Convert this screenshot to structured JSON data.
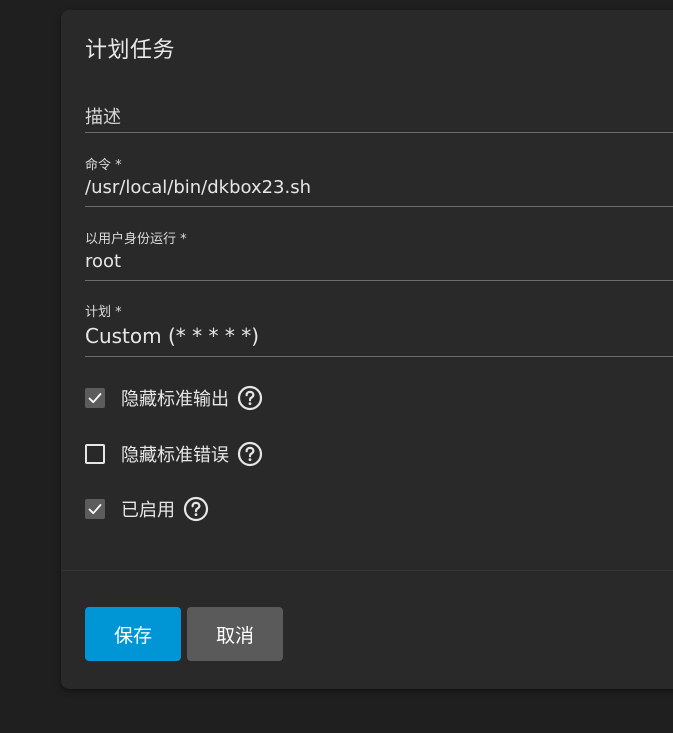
{
  "dialog": {
    "title": "计划任务",
    "fields": {
      "description": {
        "placeholder": "描述",
        "value": ""
      },
      "command": {
        "label": "命令 *",
        "value": "/usr/local/bin/dkbox23.sh"
      },
      "run_as_user": {
        "label": "以用户身份运行 *",
        "value": "root"
      },
      "schedule": {
        "label": "计划 *",
        "value": "Custom (* * * * *)"
      }
    },
    "checkboxes": [
      {
        "label": "隐藏标准输出",
        "checked": true
      },
      {
        "label": "隐藏标准错误",
        "checked": false
      },
      {
        "label": "已启用",
        "checked": true
      }
    ],
    "buttons": {
      "save": "保存",
      "cancel": "取消"
    }
  },
  "colors": {
    "page_background": "#1f1f1f",
    "dialog_background": "#292929",
    "primary_button": "#0095d5",
    "secondary_button": "#5a5a5a"
  },
  "icons": {
    "check": "check-icon",
    "help": "help-circle-icon"
  }
}
